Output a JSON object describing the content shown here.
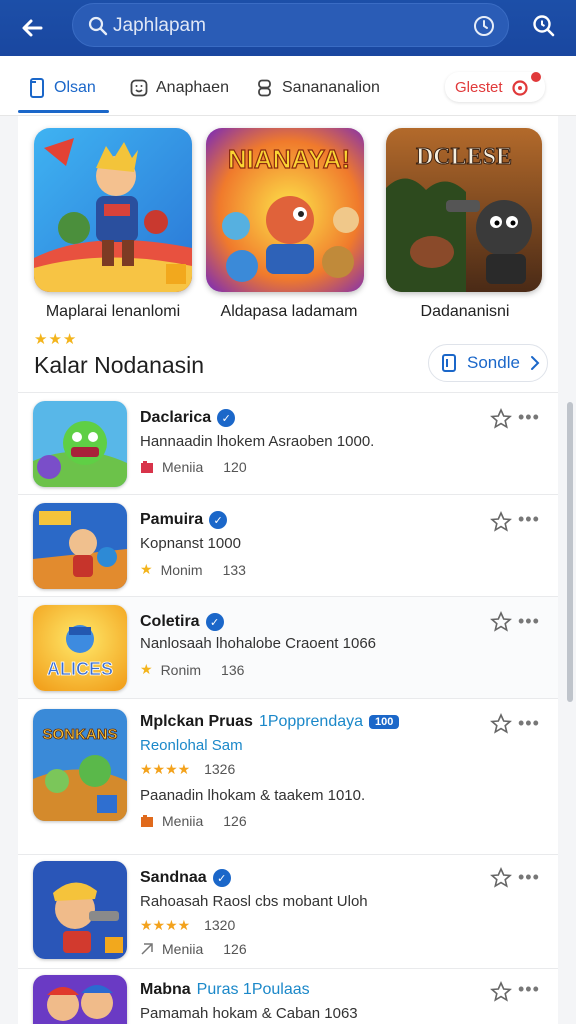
{
  "search": {
    "query": "Japhlapam"
  },
  "tabs": [
    {
      "label": "Olsan",
      "active": true
    },
    {
      "label": "Anaphaen"
    },
    {
      "label": "Sanananalion"
    }
  ],
  "tab_extra": {
    "label": "Glestet"
  },
  "featured": [
    {
      "title": "Maplarai lenanlomi",
      "art": "hero-knight"
    },
    {
      "title": "Aldapasa ladamam",
      "art": "party-heroes",
      "banner": "NIANAYA!"
    },
    {
      "title": "Dadananisni",
      "art": "dark-boss",
      "banner": "DCLESE"
    }
  ],
  "featured_rating": "★★★",
  "section": {
    "title": "Kalar Nodanasin",
    "see_more": "Sondle"
  },
  "apps": [
    {
      "name": "Daclarica",
      "badge": "verified",
      "desc": "Hannaadin lhokem Asraoben 1000.",
      "meta_label": "Meniia",
      "meta_value": "120",
      "meta_icon": "tag-icon"
    },
    {
      "name": "Pamuira",
      "badge": "verified",
      "desc": "Kopnanst 1000",
      "meta_label": "Monim",
      "meta_value": "133",
      "meta_icon": "star-icon"
    },
    {
      "name": "Coletira",
      "badge": "verified",
      "desc": "Nanlosaah lhohalobe Craoent 1066",
      "meta_label": "Ronim",
      "meta_value": "136",
      "meta_icon": "star-icon",
      "icon_banner": "ALICES"
    },
    {
      "name": "Mplckan Pruas",
      "extra": "1Popprendaya",
      "pill": "100",
      "subtitle": "Reonlohal Sam",
      "stars": "★★★★",
      "stars_value": "1326",
      "desc": "Paanadin lhokam & taakem 1010.",
      "meta_label": "Meniia",
      "meta_value": "126",
      "meta_icon": "tag-icon",
      "icon_banner": "SONKANS"
    },
    {
      "name": "Sandnaa",
      "badge": "verified",
      "desc": "Rahoasah Raosl cbs mobant Uloh",
      "stars": "★★★★",
      "stars_value": "1320",
      "meta_label": "Meniia",
      "meta_value": "126",
      "meta_icon": "outline-tag-icon"
    },
    {
      "name": "Mabna",
      "extra": "Puras 1Poulaas",
      "desc": "Pamamah hokam & Caban 1063",
      "meta_label": "",
      "meta_value": ""
    }
  ],
  "colors": {
    "appbar": "#1c4fa8",
    "accent": "#1b67c9",
    "star": "#f3b41c",
    "alert": "#e0393a"
  }
}
